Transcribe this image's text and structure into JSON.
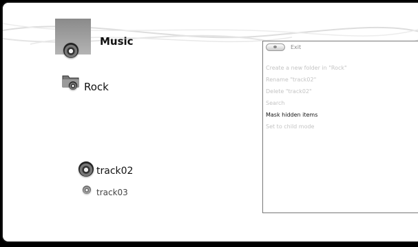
{
  "header": {
    "title": "Music"
  },
  "folder": {
    "label": "Rock"
  },
  "tracks": [
    {
      "label": "track02"
    },
    {
      "label": "track03"
    }
  ],
  "menu": {
    "exit_label": "Exit",
    "items": [
      {
        "label": "Create a new folder in \"Rock\"",
        "enabled": false
      },
      {
        "label": "Rename \"track02\"",
        "enabled": false
      },
      {
        "label": "Delete \"track02\"",
        "enabled": false
      },
      {
        "label": "Search",
        "enabled": false
      },
      {
        "label": "Mask hidden items",
        "enabled": true
      },
      {
        "label": "Set to child mode",
        "enabled": false
      }
    ]
  }
}
